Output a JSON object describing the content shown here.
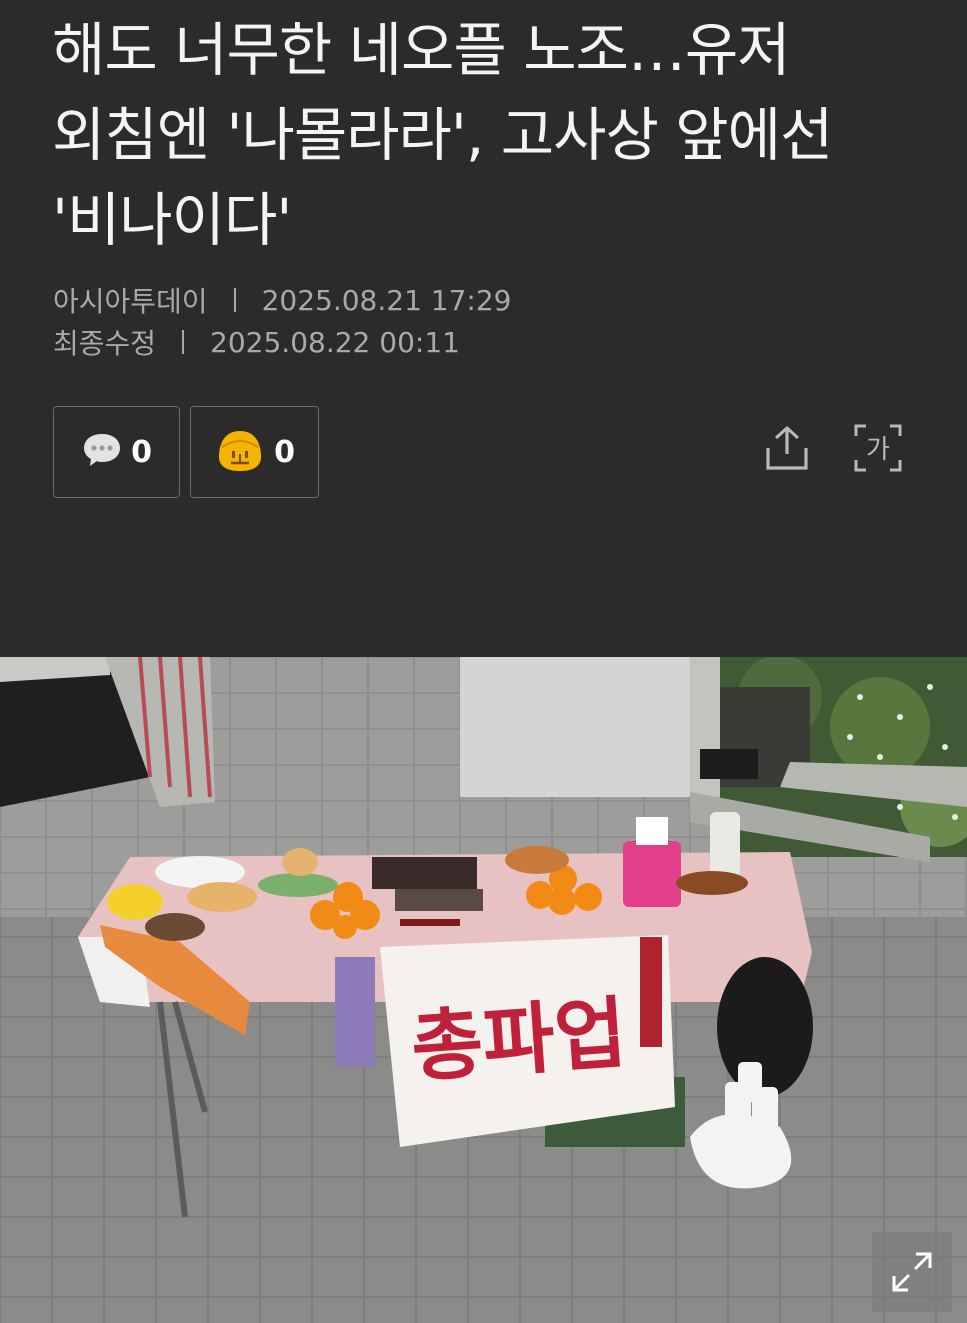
{
  "article": {
    "headline": "해도 너무한 네오플 노조…유저 외침엔 '나몰라라', 고사상 앞에선 '비나이다'",
    "source": "아시아투데이",
    "published": "2025.08.21 17:29",
    "modified_label": "최종수정",
    "modified": "2025.08.22 00:11"
  },
  "reactions": {
    "comment_count": "0",
    "angry_count": "0"
  },
  "icons": {
    "comment": "speech-bubble-icon",
    "angry": "angry-face-icon",
    "share": "share-icon",
    "font_size": "font-size-icon",
    "expand": "expand-icon"
  },
  "photo": {
    "banner_text": "총파업"
  },
  "colors": {
    "background": "#2b2b2b",
    "headline": "#f4f4f4",
    "meta": "#a9a9a9",
    "angry_face": "#f5b400",
    "banner_text": "#c0213a"
  }
}
